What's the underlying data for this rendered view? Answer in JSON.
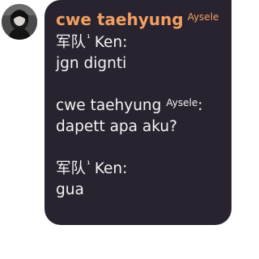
{
  "avatar": {
    "icon": "user-avatar-photo"
  },
  "bubble": {
    "background": "#29232f",
    "sender": {
      "name": "cwe taehyung",
      "tag": "Aysele",
      "color": "#f0a063"
    },
    "lines": {
      "l1_name": "军队",
      "l1_sup": "¹",
      "l1_rest": "Ken:",
      "l2": "jgn dignti",
      "l3_name": "cwe taehyung",
      "l3_sup": "Aysele",
      "l3_colon": ":",
      "l4": "dapett apa aku?",
      "l5_name": "军队",
      "l5_sup": "¹",
      "l5_rest": "Ken:",
      "l6": "gua"
    }
  }
}
